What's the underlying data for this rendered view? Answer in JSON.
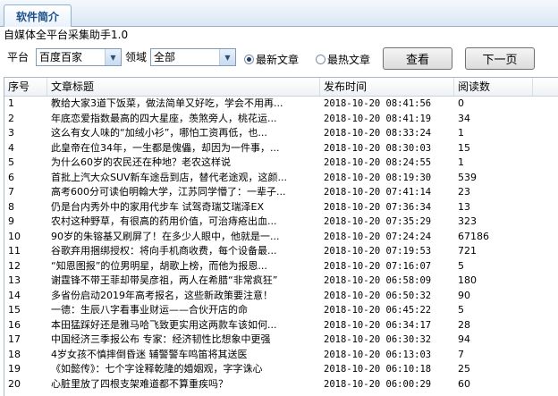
{
  "tab": {
    "label": "软件简介"
  },
  "app_title": "自媒体全平台采集助手1.0",
  "toolbar": {
    "platform_label": "平台",
    "platform_value": "百度百家",
    "field_label": "领域",
    "field_value": "全部",
    "radio_latest_label": "最新文章",
    "radio_hot_label": "最热文章",
    "radio_selected": "latest",
    "view_button": "查看",
    "next_button": "下一页"
  },
  "grid": {
    "columns": [
      "序号",
      "文章标题",
      "发布时间",
      "阅读数"
    ],
    "rows": [
      {
        "no": "1",
        "title": "教给大家3道下饭菜，做法简单又好吃，学会不用再...",
        "time": "2018-10-20 08:41:56",
        "reads": "0"
      },
      {
        "no": "2",
        "title": "年底恋爱指数最高的四大星座，羡煞旁人，桃花运...",
        "time": "2018-10-20 08:41:19",
        "reads": "34"
      },
      {
        "no": "3",
        "title": "这么有女人味的“加绒小衫”，哪怕工资再低，也...",
        "time": "2018-10-20 08:33:24",
        "reads": "1"
      },
      {
        "no": "4",
        "title": "此皇帝在位34年，一生都是傀儡，却因为一件事，...",
        "time": "2018-10-20 08:30:03",
        "reads": "15"
      },
      {
        "no": "5",
        "title": "为什么60岁的农民还在种地？老农这样说",
        "time": "2018-10-20 08:24:55",
        "reads": "1"
      },
      {
        "no": "6",
        "title": "首批上汽大众SUV新车途岳到店，替代老途观，这颜...",
        "time": "2018-10-20 08:19:30",
        "reads": "539"
      },
      {
        "no": "7",
        "title": "高考600分可读伯明翰大学，江苏同学懵了：一辈子...",
        "time": "2018-10-20 07:41:14",
        "reads": "23"
      },
      {
        "no": "8",
        "title": "仍是台内秀外中的家用代步车 试驾奇瑞艾瑞泽EX",
        "time": "2018-10-20 07:36:34",
        "reads": "13"
      },
      {
        "no": "9",
        "title": "农村这种野草，有很高的药用价值，可治痔疮出血...",
        "time": "2018-10-20 07:35:29",
        "reads": "323"
      },
      {
        "no": "10",
        "title": "90岁的朱镕基又刷屏了！在多少人眼中，他就是一...",
        "time": "2018-10-20 07:24:24",
        "reads": "67186"
      },
      {
        "no": "11",
        "title": "谷歌弃用捆绑授权：将向手机商收费，每个设备最...",
        "time": "2018-10-20 07:19:53",
        "reads": "721"
      },
      {
        "no": "12",
        "title": "“知恩图报”的位男明星，胡歌上榜，而他为报恩...",
        "time": "2018-10-20 07:16:07",
        "reads": "5"
      },
      {
        "no": "13",
        "title": "谢霆锋不带王菲却带吴彦祖，两人在希腊“非常疯狂”",
        "time": "2018-10-20 06:58:09",
        "reads": "180"
      },
      {
        "no": "14",
        "title": "多省份启动2019年高考报名，这些新政策要注意！",
        "time": "2018-10-20 06:50:32",
        "reads": "90"
      },
      {
        "no": "15",
        "title": "一德：生辰八字看事业财运——合伙开店的命",
        "time": "2018-10-20 06:45:22",
        "reads": "5"
      },
      {
        "no": "16",
        "title": "本田猛踩好还是雅马哈飞致更实用这两款车该如何...",
        "time": "2018-10-20 06:34:17",
        "reads": "28"
      },
      {
        "no": "17",
        "title": "中国经济三季报公布 专家：经济韧性比想象中更强",
        "time": "2018-10-20 06:30:32",
        "reads": "94"
      },
      {
        "no": "18",
        "title": "4岁女孩不慎摔倒昏迷 辅警警车鸣笛将其送医",
        "time": "2018-10-20 06:13:03",
        "reads": "7"
      },
      {
        "no": "19",
        "title": "《如懿传》：七个字诠释乾隆的婚姻观，字字诛心",
        "time": "2018-10-20 06:10:18",
        "reads": "25"
      },
      {
        "no": "20",
        "title": "心脏里放了四根支架难道都不算重疾吗？",
        "time": "2018-10-20 06:00:29",
        "reads": "60"
      }
    ]
  }
}
